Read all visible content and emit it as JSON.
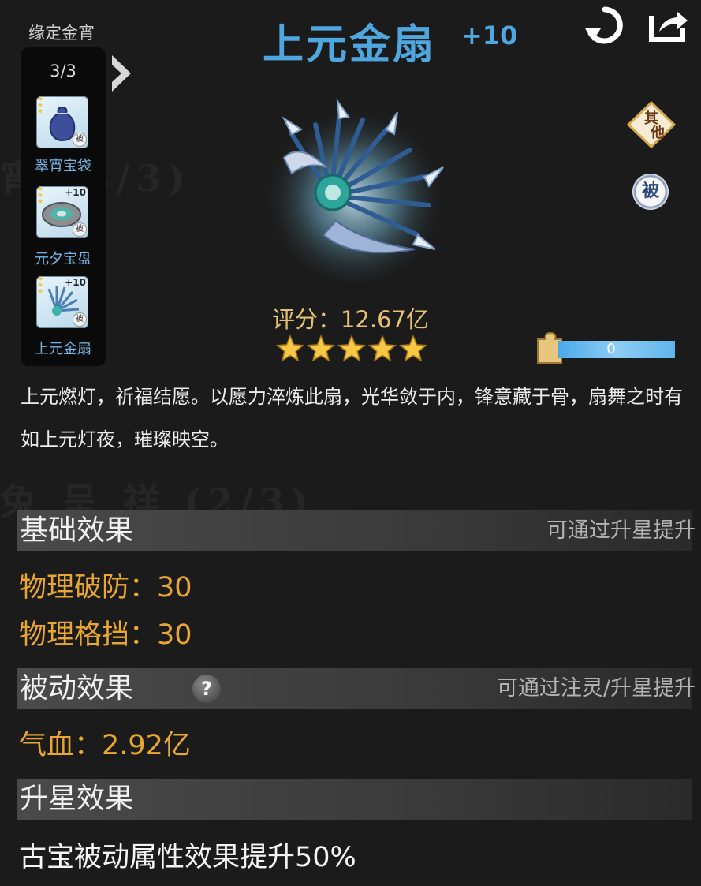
{
  "set": {
    "label": "缘定金宵",
    "count": "3/3",
    "items": [
      {
        "name": "翠宵宝袋",
        "plus": "",
        "passive_mark": "被",
        "icon": "pouch-icon"
      },
      {
        "name": "元夕宝盘",
        "plus": "+10",
        "passive_mark": "被",
        "icon": "plate-icon"
      },
      {
        "name": "上元金扇",
        "plus": "+10",
        "passive_mark": "被",
        "icon": "fan-icon"
      }
    ]
  },
  "item": {
    "name": "上元金扇",
    "plus": "+10",
    "score": "评分：12.67亿",
    "stars": 5,
    "description": "上元燃灯，祈福结愿。以愿力淬炼此扇，光华敛于内，锋意藏于骨，扇舞之时有如上元灯夜，璀璨映空。"
  },
  "badges": {
    "other": "其他",
    "passive": "被"
  },
  "progress": {
    "value": "0",
    "fill_fraction": 1.0
  },
  "sections": {
    "basic": {
      "title": "基础效果",
      "hint": "可通过升星提升",
      "attrs": [
        "物理破防：30",
        "物理格挡：30"
      ]
    },
    "passive": {
      "title": "被动效果",
      "hint": "可通过注灵/升星提升",
      "help": "?",
      "attrs": [
        "气血：2.92亿"
      ]
    },
    "star_up": {
      "title": "升星效果",
      "text": "古宝被动属性效果提升50%"
    }
  },
  "colors": {
    "title_blue": "#4fa7df",
    "gold": "#e6c173",
    "attr_orange": "#e9a732",
    "panel_bg": "#1b1b1b"
  }
}
